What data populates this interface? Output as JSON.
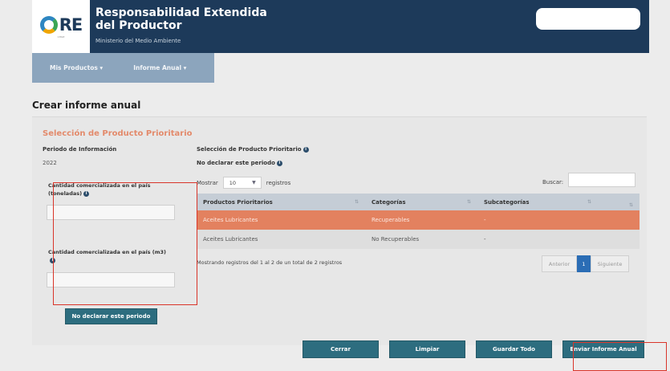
{
  "header": {
    "logo_text": "RE",
    "logo_sub": "CHILE",
    "title": "Responsabilidad Extendida del Productor",
    "subtitle": "Ministerio del Medio Ambiente"
  },
  "nav": {
    "items": [
      {
        "label": "Mis Productos ▾"
      },
      {
        "label": "Informe Anual ▾"
      }
    ]
  },
  "page": {
    "title": "Crear informe anual"
  },
  "section": {
    "heading": "Selección de Producto Prioritario",
    "period_label": "Periodo de Información",
    "period_value": "2022",
    "qty_tons_label": "Cantidad comercializada en el país (toneladas)",
    "qty_m3_label": "Cantidad comercializada en el país (m3)",
    "no_declare_button": "No declarar este periodo"
  },
  "selection": {
    "label": "Selección de Producto Prioritario",
    "no_declare_label": "No declarar este periodo",
    "show_prefix": "Mostrar",
    "show_value": "10",
    "show_suffix": "registros",
    "search_label": "Buscar:",
    "search_value": ""
  },
  "table": {
    "headers": [
      "Productos Prioritarios",
      "Categorías",
      "Subcategorías"
    ],
    "rows": [
      {
        "producto": "Aceites Lubricantes",
        "categoria": "Recuperables",
        "subcategoria": "-"
      },
      {
        "producto": "Aceites Lubricantes",
        "categoria": "No Recuperables",
        "subcategoria": "-"
      }
    ],
    "info": "Mostrando registros del 1 al 2 de un total de 2 registros",
    "pager": {
      "prev": "Anterior",
      "current": "1",
      "next": "Siguiente"
    }
  },
  "actions": {
    "close": "Cerrar",
    "clear": "Limpiar",
    "save_all": "Guardar Todo",
    "send": "Enviar Informe Anual"
  },
  "icons": {
    "info": "info-icon",
    "sort": "sort-icon",
    "chevron": "chevron-down-icon",
    "logo": "recycle-logo-icon"
  },
  "colors": {
    "header_bg": "#1d3a5a",
    "nav_bg": "#8ca5bd",
    "accent": "#e3815f",
    "button_bg": "#2d6d7f",
    "highlight": "#d9352a"
  }
}
